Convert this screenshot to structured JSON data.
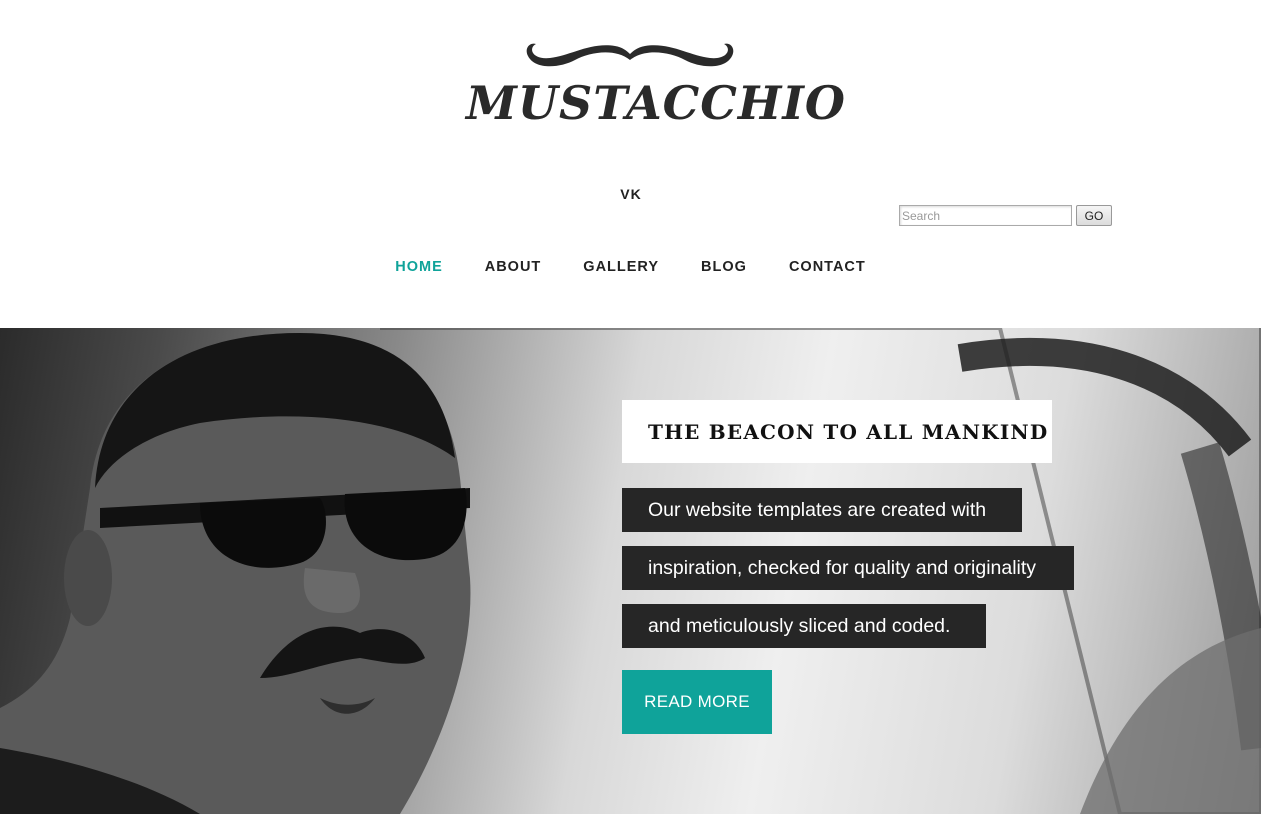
{
  "site": {
    "logo_text": "MUSTACCHIO",
    "social_link": "VK",
    "search": {
      "placeholder": "Search",
      "button_label": "GO"
    }
  },
  "nav": {
    "items": [
      {
        "label": "HOME",
        "active": true
      },
      {
        "label": "ABOUT",
        "active": false
      },
      {
        "label": "GALLERY",
        "active": false
      },
      {
        "label": "BLOG",
        "active": false
      },
      {
        "label": "CONTACT",
        "active": false
      }
    ]
  },
  "hero": {
    "title": "THE BEACON TO ALL MANKIND",
    "lines": [
      "Our website templates are created with",
      "inspiration, checked for quality and originality",
      "and meticulously sliced and coded."
    ],
    "button_label": "READ MORE"
  },
  "colors": {
    "accent": "#0fa39a",
    "dark_band": "#262626",
    "text": "#222222"
  }
}
